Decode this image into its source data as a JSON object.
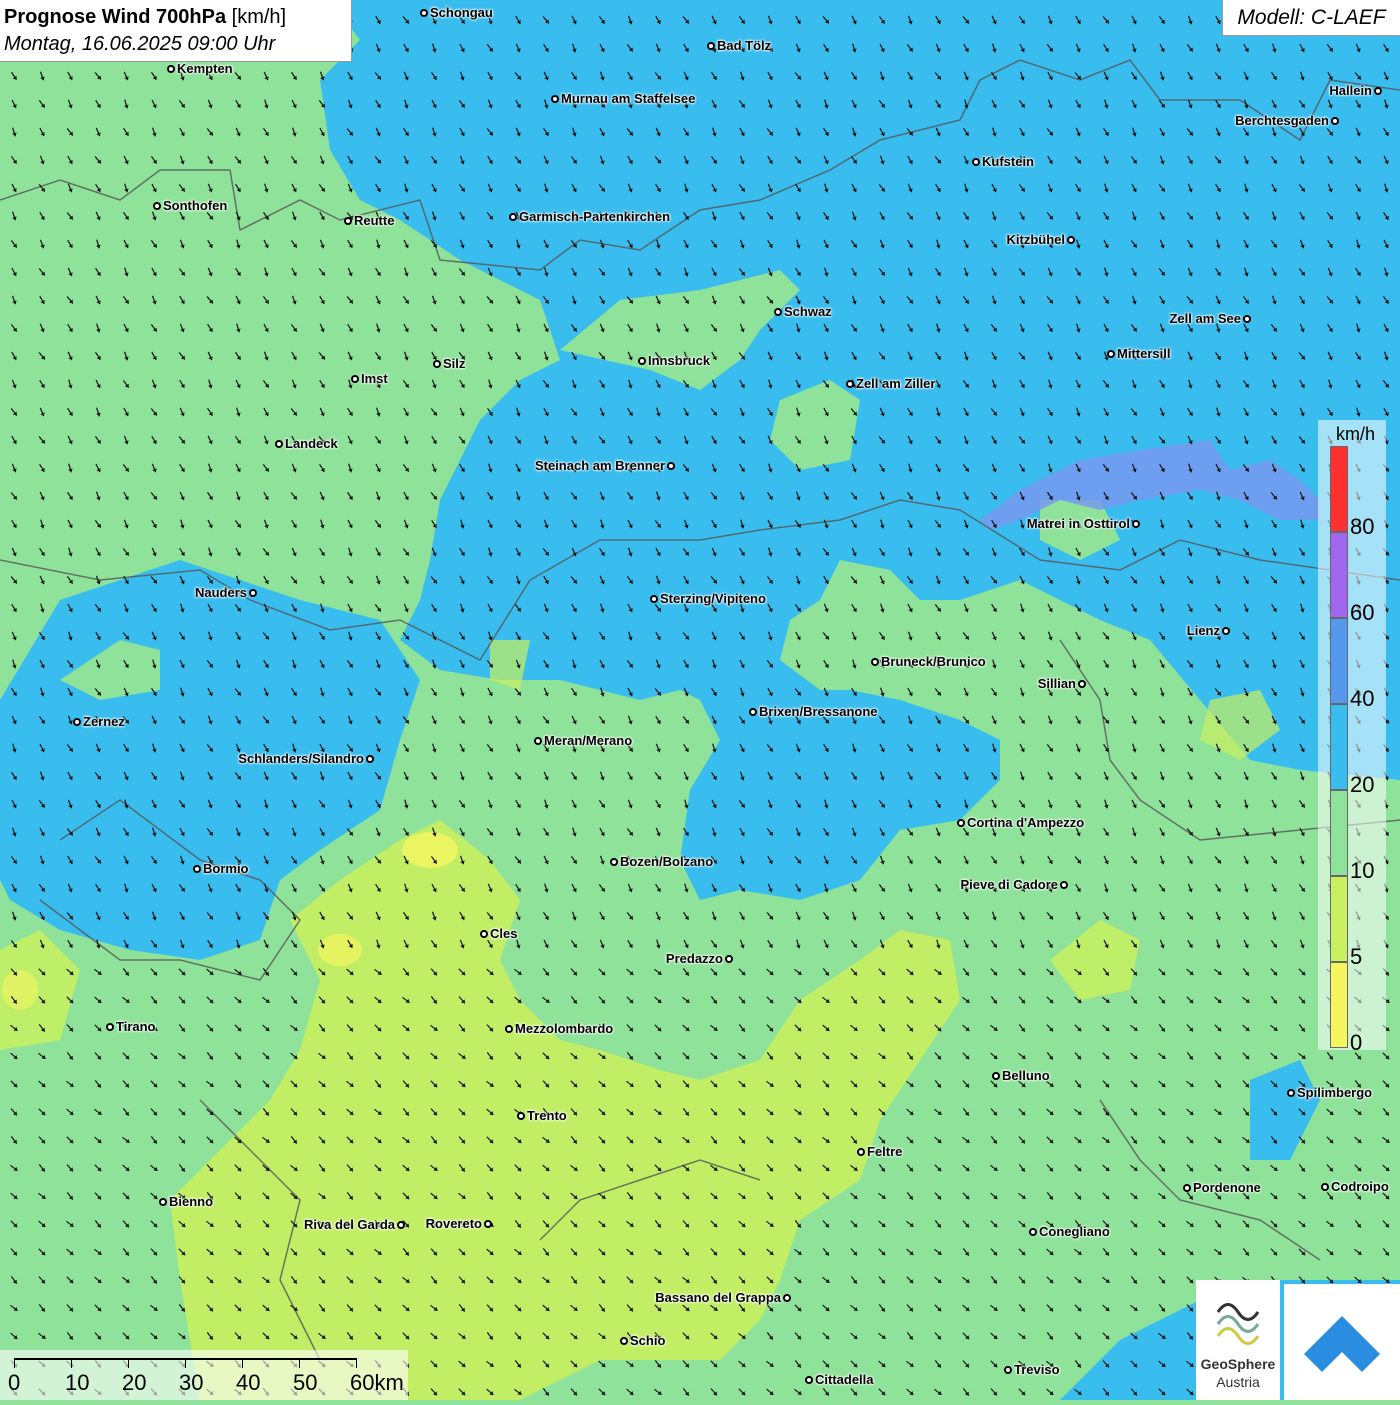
{
  "title": {
    "main": "Prognose Wind 700hPa",
    "unit": "[km/h]",
    "date": "Montag, 16.06.2025 09:00 Uhr"
  },
  "model": "Modell: C-LAEF",
  "legend": {
    "unit": "km/h",
    "ticks": [
      "80",
      "60",
      "40",
      "20",
      "10",
      "5",
      "0"
    ],
    "colors": [
      "#ff3030",
      "#a066ee",
      "#5599ee",
      "#39bdee",
      "#8fe29a",
      "#c8f060",
      "#f5f560"
    ]
  },
  "scale_bar": {
    "labels": [
      "0",
      "10",
      "20",
      "30",
      "40",
      "50",
      "60km"
    ]
  },
  "brand": {
    "name": "GeoSphere",
    "sub": "Austria",
    "icon": "geosphere-logo-icon",
    "app_icon": "wind-app-icon"
  },
  "cities": [
    {
      "name": "Schongau"
    },
    {
      "name": "Bad Tölz"
    },
    {
      "name": "Kempten"
    },
    {
      "name": "Murnau am Staffelsee"
    },
    {
      "name": "Hallein"
    },
    {
      "name": "Berchtesgaden"
    },
    {
      "name": "Kufstein"
    },
    {
      "name": "Sonthofen"
    },
    {
      "name": "Reutte"
    },
    {
      "name": "Garmisch-Partenkirchen"
    },
    {
      "name": "Kitzbühel"
    },
    {
      "name": "Schwaz"
    },
    {
      "name": "Zell am See"
    },
    {
      "name": "Mittersill"
    },
    {
      "name": "Innsbruck"
    },
    {
      "name": "Silz"
    },
    {
      "name": "Imst"
    },
    {
      "name": "Zell am Ziller"
    },
    {
      "name": "Landeck"
    },
    {
      "name": "Steinach am Brenner"
    },
    {
      "name": "Matrei in Osttirol"
    },
    {
      "name": "Nauders"
    },
    {
      "name": "Sterzing/Vipiteno"
    },
    {
      "name": "Lienz"
    },
    {
      "name": "Bruneck/Brunico"
    },
    {
      "name": "Sillian"
    },
    {
      "name": "Brixen/Bressanone"
    },
    {
      "name": "Zernez"
    },
    {
      "name": "Meran/Merano"
    },
    {
      "name": "Schlanders/Silandro"
    },
    {
      "name": "Cortina d'Ampezzo"
    },
    {
      "name": "Bozen/Bolzano"
    },
    {
      "name": "Bormio"
    },
    {
      "name": "Pieve di Cadore"
    },
    {
      "name": "Cles"
    },
    {
      "name": "Predazzo"
    },
    {
      "name": "Tirano"
    },
    {
      "name": "Mezzolombardo"
    },
    {
      "name": "Belluno"
    },
    {
      "name": "Spilimbergo"
    },
    {
      "name": "Trento"
    },
    {
      "name": "Feltre"
    },
    {
      "name": "Bienno"
    },
    {
      "name": "Pordenone"
    },
    {
      "name": "Codroipo"
    },
    {
      "name": "Riva del Garda"
    },
    {
      "name": "Rovereto"
    },
    {
      "name": "Conegliano"
    },
    {
      "name": "Bassano del Grappa"
    },
    {
      "name": "Schio"
    },
    {
      "name": "Treviso"
    },
    {
      "name": "Cittadella"
    }
  ]
}
